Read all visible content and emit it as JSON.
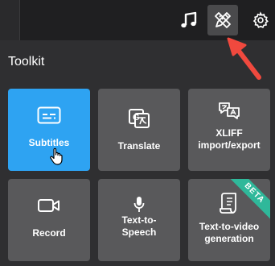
{
  "toolbar": {
    "music_icon": "music-note-icon",
    "tools_icon": "pencil-ruler-icon",
    "settings_icon": "gear-icon"
  },
  "toolkit": {
    "title": "Toolkit",
    "tiles": [
      {
        "label": "Subtitles",
        "icon": "subtitles-icon",
        "active": true
      },
      {
        "label": "Translate",
        "icon": "translate-icon"
      },
      {
        "label": "XLIFF import/export",
        "icon": "language-icon"
      },
      {
        "label": "Record",
        "icon": "video-camera-icon"
      },
      {
        "label": "Text-to-Speech",
        "icon": "microphone-icon"
      },
      {
        "label": "Text-to-video generation",
        "icon": "scroll-icon",
        "badge": "BETA"
      }
    ]
  },
  "colors": {
    "active_tile": "#2ea3f2",
    "tile": "#59595b",
    "beta_ribbon": "#2fb89a",
    "annotation_arrow": "#f0493e"
  }
}
